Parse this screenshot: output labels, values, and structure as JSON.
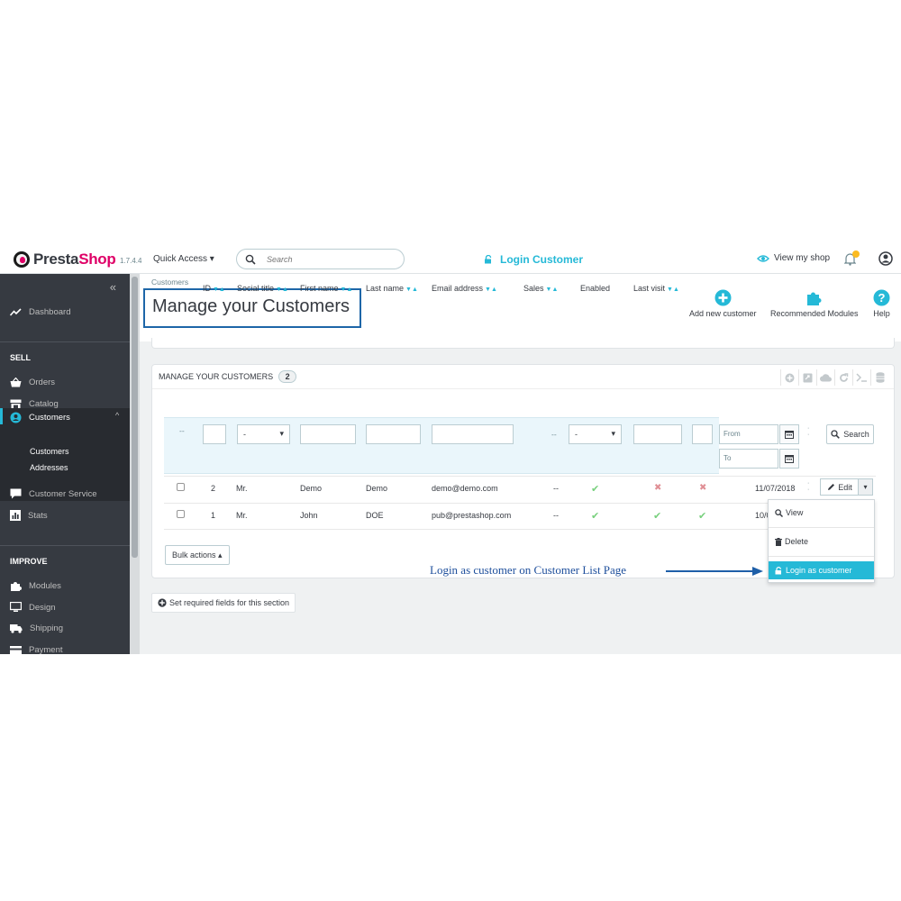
{
  "header": {
    "logo_prefix": "Presta",
    "logo_suffix": "Shop",
    "version": "1.7.4.4",
    "quick_access": "Quick Access",
    "search_placeholder": "Search",
    "login_customer": "Login Customer",
    "view_shop": "View my shop"
  },
  "sidebar": {
    "collapse": "«",
    "dashboard": "Dashboard",
    "section_sell": "SELL",
    "orders": "Orders",
    "catalog": "Catalog",
    "customers": "Customers",
    "sub_customers": "Customers",
    "sub_addresses": "Addresses",
    "customer_service": "Customer Service",
    "stats": "Stats",
    "section_improve": "IMPROVE",
    "modules": "Modules",
    "design": "Design",
    "shipping": "Shipping",
    "payment": "Payment"
  },
  "page": {
    "breadcrumb": "Customers",
    "title": "Manage your Customers",
    "toolbar": {
      "add_new": "Add new customer",
      "recommended": "Recommended Modules",
      "help": "Help"
    }
  },
  "panel": {
    "title": "MANAGE YOUR CUSTOMERS",
    "count": "2",
    "columns": {
      "id": "ID",
      "social_title": "Social title",
      "first_name": "First name",
      "last_name": "Last name",
      "email": "Email address",
      "sales": "Sales",
      "enabled": "Enabled",
      "last_visit": "Last visit"
    },
    "sort_arrows": "▼▲",
    "filters": {
      "dash": "--",
      "social_select": "-",
      "sales_dash": "--",
      "enabled_select": "-",
      "from": "From",
      "to": "To",
      "search": "Search"
    },
    "rows": [
      {
        "id": "2",
        "social": "Mr.",
        "first": "Demo",
        "last": "Demo",
        "email": "demo@demo.com",
        "sales": "--",
        "last_visit": "11/07/2018"
      },
      {
        "id": "1",
        "social": "Mr.",
        "first": "John",
        "last": "DOE",
        "email": "pub@prestashop.com",
        "sales": "--",
        "last_visit": "10/0"
      }
    ],
    "edit": "Edit",
    "bulk_actions": "Bulk actions ▴"
  },
  "dropdown": {
    "view": "View",
    "delete": "Delete",
    "login_as": "Login as customer"
  },
  "annotation": "Login as customer on Customer List Page",
  "required_fields": "Set required fields for this section",
  "colors": {
    "accent": "#25b9d7",
    "brand_pink": "#df0067",
    "sidebar_bg": "#363a41",
    "annotation_blue": "#1e4f9c",
    "success": "#78d07d",
    "danger": "#e08f95"
  },
  "icons": [
    "search-icon",
    "unlock-icon",
    "eye-icon",
    "bell-icon",
    "user-icon",
    "trend-icon",
    "basket-icon",
    "store-icon",
    "account-icon",
    "chat-icon",
    "stats-icon",
    "puzzle-icon",
    "desktop-icon",
    "truck-icon",
    "card-icon",
    "plus-circle-icon",
    "help-icon",
    "calendar-icon",
    "pencil-icon",
    "trash-icon",
    "check-icon",
    "cross-icon"
  ]
}
